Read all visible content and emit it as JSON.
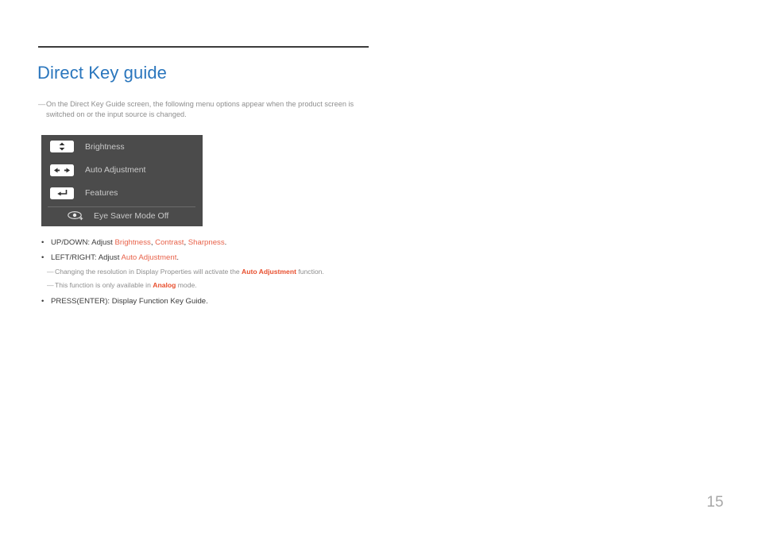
{
  "page": {
    "title": "Direct Key guide",
    "page_number": "15",
    "title_color": "#2a76bd",
    "highlight_color": "#e8624a",
    "highlight_strong_color": "#e8502f",
    "note_color": "#8e8e8e"
  },
  "intro_note": {
    "marker": "—",
    "text": "On the Direct Key Guide screen, the following menu options appear when the product screen is switched on or the input source is changed."
  },
  "osd": {
    "background": "#4b4b4b",
    "rows": [
      {
        "icon": "up-down-arrow-icon",
        "label": "Brightness"
      },
      {
        "icon": "left-right-arrow-icon",
        "label": "Auto Adjustment"
      },
      {
        "icon": "enter-return-arrow-icon",
        "label": "Features"
      }
    ],
    "eye_row": {
      "icon": "eye-saver-icon",
      "label": "Eye Saver Mode Off"
    }
  },
  "bullets": [
    {
      "marker": "•",
      "segments": [
        {
          "text": "UP/DOWN: Adjust ",
          "style": "plain"
        },
        {
          "text": "Brightness",
          "style": "hl"
        },
        {
          "text": ", ",
          "style": "plain"
        },
        {
          "text": "Contrast",
          "style": "hl"
        },
        {
          "text": ", ",
          "style": "plain"
        },
        {
          "text": "Sharpness",
          "style": "hl"
        },
        {
          "text": ".",
          "style": "plain"
        }
      ]
    },
    {
      "marker": "•",
      "segments": [
        {
          "text": "LEFT/RIGHT: Adjust ",
          "style": "plain"
        },
        {
          "text": "Auto Adjustment",
          "style": "hl"
        },
        {
          "text": ".",
          "style": "plain"
        }
      ]
    }
  ],
  "subnotes": [
    {
      "marker": "—",
      "segments": [
        {
          "text": "Changing the resolution in Display Properties will activate the ",
          "style": "plain"
        },
        {
          "text": "Auto Adjustment",
          "style": "hl-strong"
        },
        {
          "text": " function.",
          "style": "plain"
        }
      ]
    },
    {
      "marker": "—",
      "segments": [
        {
          "text": "This function is only available in ",
          "style": "plain"
        },
        {
          "text": "Analog",
          "style": "hl-strong"
        },
        {
          "text": " mode.",
          "style": "plain"
        }
      ]
    }
  ],
  "last_bullet": {
    "marker": "•",
    "segments": [
      {
        "text": "PRESS(ENTER): Display Function Key Guide.",
        "style": "plain"
      }
    ]
  }
}
